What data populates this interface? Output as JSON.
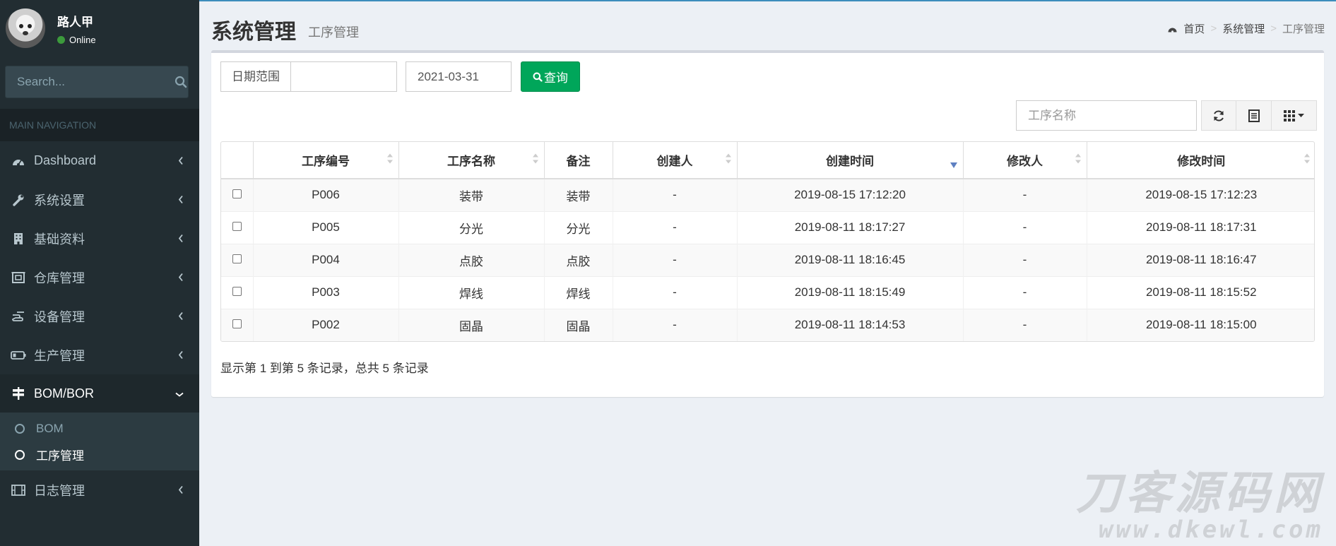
{
  "user": {
    "name": "路人甲",
    "status": "Online"
  },
  "search": {
    "placeholder": "Search..."
  },
  "nav": {
    "header": "MAIN NAVIGATION",
    "items": [
      {
        "label": "Dashboard",
        "icon": "dashboard-icon"
      },
      {
        "label": "系统设置",
        "icon": "wrench-icon"
      },
      {
        "label": "基础资料",
        "icon": "building-icon"
      },
      {
        "label": "仓库管理",
        "icon": "warehouse-icon"
      },
      {
        "label": "设备管理",
        "icon": "hand-icon"
      },
      {
        "label": "生产管理",
        "icon": "battery-icon"
      },
      {
        "label": "BOM/BOR",
        "icon": "signpost-icon"
      },
      {
        "label": "日志管理",
        "icon": "film-icon"
      }
    ],
    "submenu": [
      {
        "label": "BOM"
      },
      {
        "label": "工序管理"
      }
    ]
  },
  "header": {
    "title": "系统管理",
    "subtitle": "工序管理",
    "breadcrumb": [
      "首页",
      "系统管理",
      "工序管理"
    ]
  },
  "filter": {
    "date_label": "日期范围",
    "date_start": "",
    "date_end": "2021-03-31",
    "query_label": "查询"
  },
  "toolbar": {
    "search_placeholder": "工序名称"
  },
  "table": {
    "columns": [
      "工序编号",
      "工序名称",
      "备注",
      "创建人",
      "创建时间",
      "修改人",
      "修改时间"
    ],
    "rows": [
      [
        "P006",
        "装带",
        "装带",
        "-",
        "2019-08-15 17:12:20",
        "-",
        "2019-08-15 17:12:23"
      ],
      [
        "P005",
        "分光",
        "分光",
        "-",
        "2019-08-11 18:17:27",
        "-",
        "2019-08-11 18:17:31"
      ],
      [
        "P004",
        "点胶",
        "点胶",
        "-",
        "2019-08-11 18:16:45",
        "-",
        "2019-08-11 18:16:47"
      ],
      [
        "P003",
        "焊线",
        "焊线",
        "-",
        "2019-08-11 18:15:49",
        "-",
        "2019-08-11 18:15:52"
      ],
      [
        "P002",
        "固晶",
        "固晶",
        "-",
        "2019-08-11 18:14:53",
        "-",
        "2019-08-11 18:15:00"
      ]
    ]
  },
  "summary": "显示第 1 到第 5 条记录，总共 5 条记录",
  "watermark": {
    "line1": "刀客源码网",
    "line2": "www.dkewl.com"
  },
  "colors": {
    "sidebar": "#222d32",
    "accent": "#3c8dbc",
    "success": "#00a65a"
  }
}
